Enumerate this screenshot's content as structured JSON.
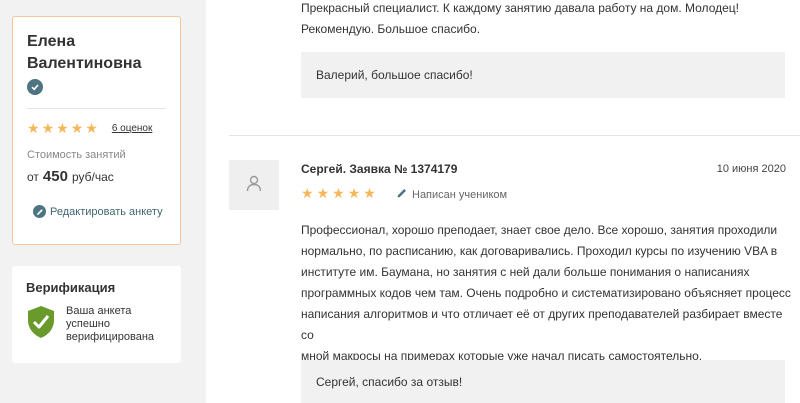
{
  "profile": {
    "name_line1": "Елена",
    "name_line2": "Валентиновна",
    "rating_stars": 5,
    "reviews_link": "6 оценок",
    "price_label": "Стоимость занятий",
    "price_prefix": "от",
    "price_value": "450",
    "price_unit": "руб/час",
    "edit_link": "Редактировать анкету"
  },
  "verification": {
    "title": "Верификация",
    "status_line1": "Ваша анкета",
    "status_line2": "успешно",
    "status_line3": "верифицирована"
  },
  "reviews": [
    {
      "text_line1": "Прекрасный специалист. К каждому занятию давала работу на дом. Молодец!",
      "text_line2": "Рекомендую. Большое спасибо.",
      "reply": "Валерий, большое спасибо!"
    },
    {
      "author": "Сергей. Заявка № 1374179",
      "date": "10 июня 2020",
      "stars": 5,
      "author_tag": "Написан учеником",
      "text_lines": [
        "Профессионал, хорошо преподает, знает свое дело. Все хорошо, занятия проходили",
        "нормально, по расписанию, как договаривались. Проходил курсы по изучению VBA в",
        "институте им. Баумана, но занятия с ней дали больше понимания о написаниях",
        "программных кодов чем там. Очень подробно и систематизировано объясняет процесс",
        "написания алгоритмов и что отличает её от других преподавателей разбирает вместе со",
        "мной макросы на примерах которые уже начал писать самостоятельно."
      ],
      "reply": "Сергей, спасибо за отзыв!"
    }
  ],
  "colors": {
    "star": "#f6b75a",
    "accent": "#4e7481",
    "card_border": "#f3c59a",
    "shield": "#6a9a2c"
  }
}
